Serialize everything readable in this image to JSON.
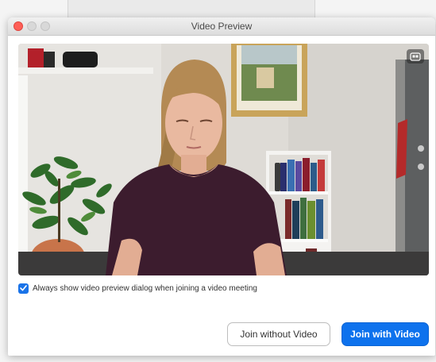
{
  "window": {
    "title": "Video Preview"
  },
  "preview": {
    "option_label": "Always show video preview dialog when joining a video meeting",
    "option_checked": true
  },
  "actions": {
    "join_without_video": "Join without Video",
    "join_with_video": "Join with Video"
  },
  "colors": {
    "accent": "#0e72ed",
    "close_button": "#fe5f57"
  },
  "icons": {
    "camera_toggle": "camera-switch-icon",
    "checkbox": "checkmark-icon"
  }
}
